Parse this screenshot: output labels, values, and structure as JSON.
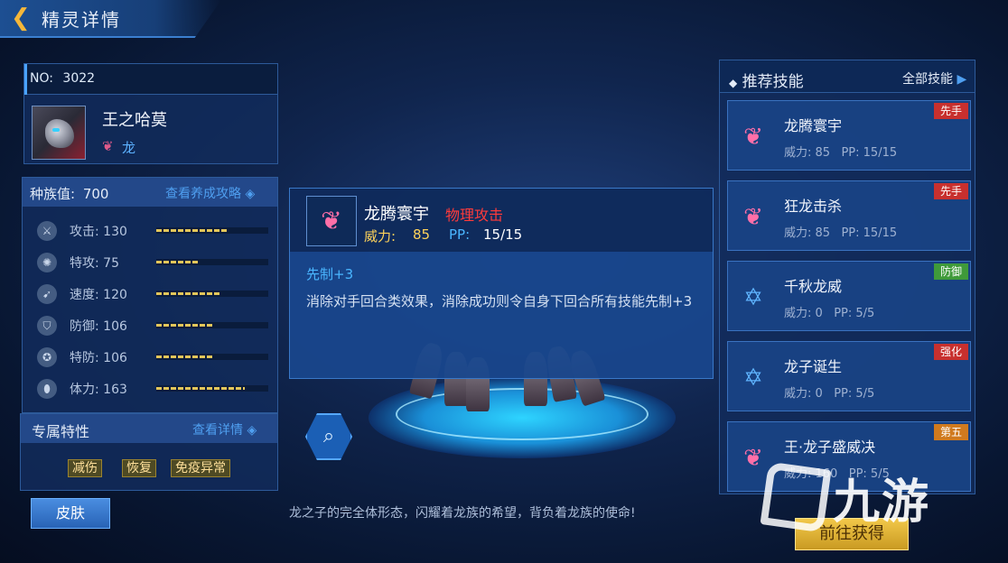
{
  "header": {
    "back_icon": "chevron-left-icon",
    "title": "精灵详情"
  },
  "pet": {
    "no_label": "NO:",
    "no_value": "3022",
    "name": "王之哈莫",
    "type": "龙"
  },
  "stats": {
    "title": "种族值:",
    "total": "700",
    "guide_link": "查看养成攻略",
    "rows": [
      {
        "icon": "sword-icon",
        "label": "攻击:",
        "value": "130",
        "level": 0.63
      },
      {
        "icon": "flame-icon",
        "label": "特攻:",
        "value": "75",
        "level": 0.37
      },
      {
        "icon": "boot-icon",
        "label": "速度:",
        "value": "120",
        "level": 0.58
      },
      {
        "icon": "shield-icon",
        "label": "防御:",
        "value": "106",
        "level": 0.51
      },
      {
        "icon": "magic-shield-icon",
        "label": "特防:",
        "value": "106",
        "level": 0.51
      },
      {
        "icon": "capsule-icon",
        "label": "体力:",
        "value": "163",
        "level": 0.79
      }
    ]
  },
  "traits": {
    "title": "专属特性",
    "link": "查看详情",
    "tags": [
      "减伤",
      "恢复",
      "免疫异常"
    ]
  },
  "skin_button": "皮肤",
  "description": "龙之子的完全体形态，闪耀着龙族的希望，背负着龙族的使命!",
  "tooltip": {
    "name": "龙腾寰宇",
    "category": "物理攻击",
    "power_label": "威力:",
    "power": "85",
    "pp_label": "PP:",
    "pp": "15/15",
    "priority": "先制+3",
    "text": "消除对手回合类效果，消除成功则令自身下回合所有技能先制+3"
  },
  "skills_panel": {
    "title": "推荐技能",
    "all_link": "全部技能",
    "skills": [
      {
        "name": "龙腾寰宇",
        "power": "威力: 85",
        "pp": "PP: 15/15",
        "tag": "先手",
        "tag_color": "#c8302e",
        "icon": "dragon-wing-icon"
      },
      {
        "name": "狂龙击杀",
        "power": "威力: 85",
        "pp": "PP: 15/15",
        "tag": "先手",
        "tag_color": "#c8302e",
        "icon": "dragon-wing-icon"
      },
      {
        "name": "千秋龙威",
        "power": "威力: 0",
        "pp": "PP: 5/5",
        "tag": "防御",
        "tag_color": "#3f9a3a",
        "icon": "star-icon"
      },
      {
        "name": "龙子诞生",
        "power": "威力: 0",
        "pp": "PP: 5/5",
        "tag": "强化",
        "tag_color": "#c8302e",
        "icon": "star-icon"
      },
      {
        "name": "王·龙子盛威决",
        "power": "威力: 160",
        "pp": "PP: 5/5",
        "tag": "第五",
        "tag_color": "#d07a1e",
        "icon": "dragon-wing-icon"
      }
    ]
  },
  "goto_button": "前往获得",
  "watermark": "九游"
}
